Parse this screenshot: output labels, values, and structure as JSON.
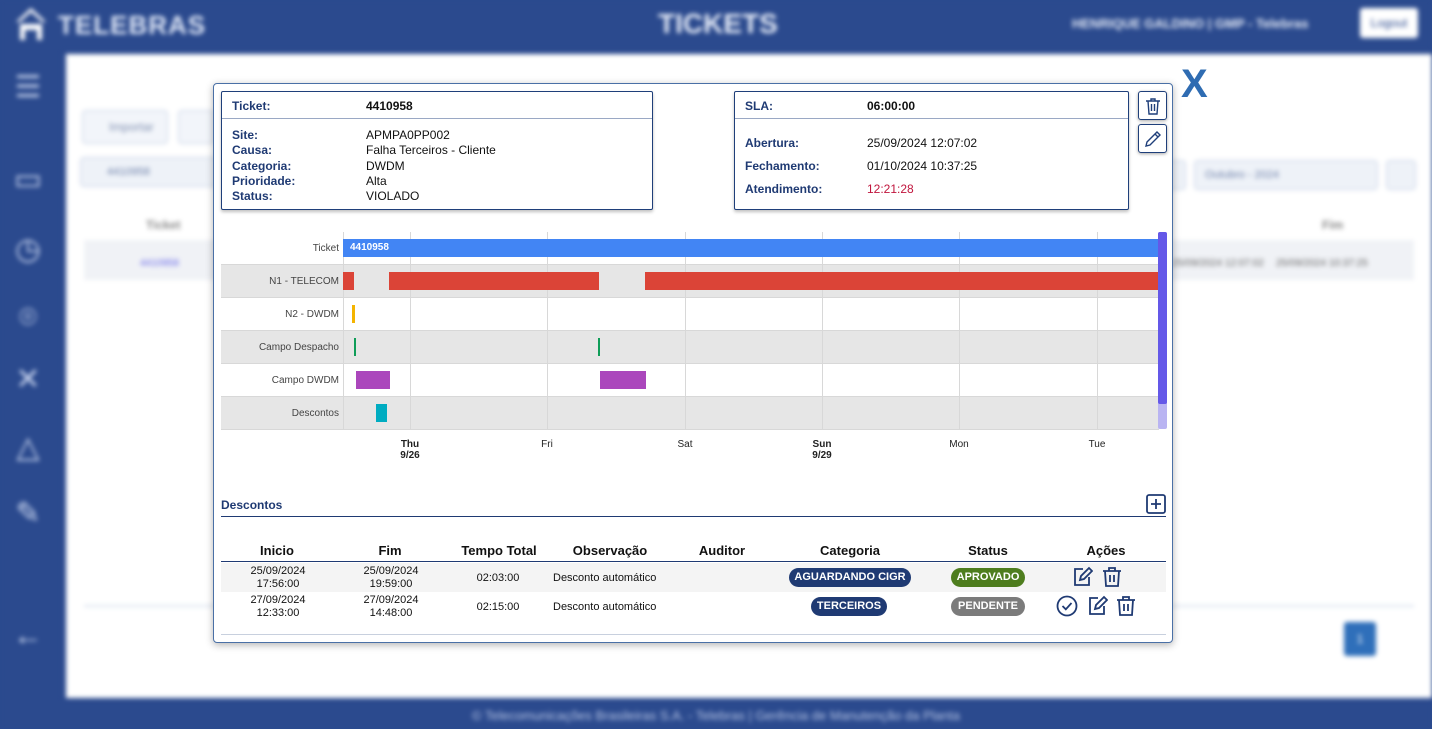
{
  "app": {
    "brand": "TELEBRAS",
    "page_title": "TICKETS",
    "user": "HENRIQUE GALDINO | GMP - Telebras",
    "logout": "Logout",
    "footer": "© Telecomunicações Brasileiras S.A. - Telebras | Gerência de Manutenção da Planta"
  },
  "background": {
    "import_button": "Importar",
    "search_value": "4410958",
    "date_filter": "Outubro - 2024",
    "col_ticket": "Ticket",
    "col_fim": "Fim",
    "row_ticket": "4410958",
    "row_abertura": "25/09/2024 12:07:02",
    "row_fim": "25/09/2024 10:37:25",
    "page": "1"
  },
  "modal": {
    "close": "X",
    "ticket_card": {
      "ticket_label": "Ticket:",
      "ticket_value": "4410958",
      "rows": [
        {
          "label": "Site:",
          "value": "APMPA0PP002"
        },
        {
          "label": "Causa:",
          "value": "Falha Terceiros - Cliente"
        },
        {
          "label": "Categoria:",
          "value": "DWDM"
        },
        {
          "label": "Prioridade:",
          "value": "Alta"
        },
        {
          "label": "Status:",
          "value": "VIOLADO"
        }
      ]
    },
    "sla_card": {
      "sla_label": "SLA:",
      "sla_value": "06:00:00",
      "rows": [
        {
          "label": "Abertura:",
          "value": "25/09/2024 12:07:02"
        },
        {
          "label": "Fechamento:",
          "value": "01/10/2024 10:37:25"
        },
        {
          "label": "Atendimento:",
          "value": "12:21:28"
        }
      ]
    }
  },
  "timeline": {
    "rows": [
      "Ticket",
      "N1 - TELECOM",
      "N2 - DWDM",
      "Campo Despacho",
      "Campo DWDM",
      "Descontos"
    ],
    "ticket_bar_label": "4410958",
    "ticks": [
      {
        "day": "Thu",
        "date": "9/26",
        "bold": true
      },
      {
        "day": "Fri",
        "date": "",
        "bold": false
      },
      {
        "day": "Sat",
        "date": "",
        "bold": false
      },
      {
        "day": "Sun",
        "date": "9/29",
        "bold": true
      },
      {
        "day": "Mon",
        "date": "",
        "bold": false
      },
      {
        "day": "Tue",
        "date": "",
        "bold": false
      }
    ],
    "colors": {
      "Ticket": "#4285f4",
      "N1 - TELECOM": "#db4437",
      "N2 - DWDM": "#f4b400",
      "Campo Despacho": "#0f9d58",
      "Campo DWDM": "#ab47bc",
      "Descontos": "#00acc1"
    }
  },
  "descontos": {
    "title": "Descontos",
    "headers": {
      "inicio": "Inicio",
      "fim": "Fim",
      "tempo_total": "Tempo Total",
      "observacao": "Observação",
      "auditor": "Auditor",
      "categoria": "Categoria",
      "status": "Status",
      "acoes": "Ações"
    },
    "rows": [
      {
        "inicio_date": "25/09/2024",
        "inicio_time": "17:56:00",
        "fim_date": "25/09/2024",
        "fim_time": "19:59:00",
        "tempo_total": "02:03:00",
        "observacao": "Desconto automático",
        "auditor": "",
        "categoria": "AGUARDANDO CIGR",
        "status": "APROVADO"
      },
      {
        "inicio_date": "27/09/2024",
        "inicio_time": "12:33:00",
        "fim_date": "27/09/2024",
        "fim_time": "14:48:00",
        "tempo_total": "02:15:00",
        "observacao": "Desconto automático",
        "auditor": "",
        "categoria": "TERCEIROS",
        "status": "PENDENTE"
      }
    ],
    "badge_colors": {
      "categoria": "#1f3a73",
      "aprovado": "#4e7d1e",
      "pendente": "#7b7b7b"
    }
  }
}
